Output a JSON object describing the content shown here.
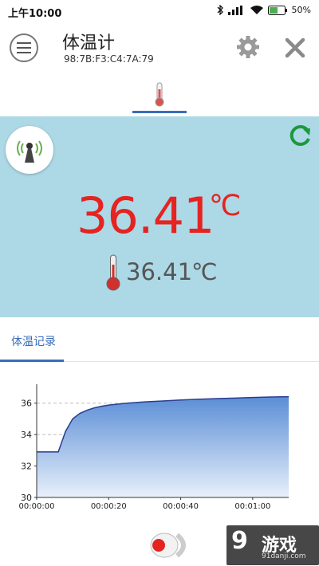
{
  "status_bar": {
    "time": "上午10:00",
    "battery": "50%"
  },
  "header": {
    "title": "体温计",
    "device_mac": "98:7B:F3:C4:7A:79",
    "icons": {
      "menu": "menu-icon",
      "settings": "gear-icon",
      "close": "close-icon"
    }
  },
  "tabs": {
    "active": "thermometer",
    "icon": "thermometer-icon"
  },
  "reading": {
    "main_value": "36.41",
    "main_unit": "℃",
    "sub_value": "36.41",
    "sub_unit": "℃",
    "main_color": "#e52421",
    "panel_color": "#add8e6"
  },
  "history": {
    "tab_label": "体温记录",
    "accent": "#3a6db8"
  },
  "chart_data": {
    "type": "area",
    "x": [
      0,
      6,
      8,
      10,
      12,
      14,
      16,
      18,
      20,
      25,
      30,
      35,
      40,
      45,
      50,
      55,
      60,
      65,
      70
    ],
    "values": [
      32.9,
      32.9,
      34.2,
      35.0,
      35.35,
      35.55,
      35.7,
      35.8,
      35.88,
      36.0,
      36.08,
      36.14,
      36.2,
      36.25,
      36.29,
      36.32,
      36.36,
      36.39,
      36.41
    ],
    "xlim": [
      0,
      70
    ],
    "ylim": [
      30,
      37
    ],
    "x_ticks": [
      "00:00:00",
      "00:00:20",
      "00:00:40",
      "00:01:00"
    ],
    "x_tick_values": [
      0,
      20,
      40,
      60
    ],
    "y_ticks": [
      "30",
      "32",
      "34",
      "36"
    ],
    "y_tick_values": [
      30,
      32,
      34,
      36
    ],
    "grid": "dashed-horizontal",
    "line_color": "#2a3d8f",
    "fill_top": "#5b8ed6",
    "fill_bottom": "#e8f0fb"
  },
  "watermark": {
    "logo": "9",
    "text": "游戏",
    "url": "91danji.com"
  }
}
